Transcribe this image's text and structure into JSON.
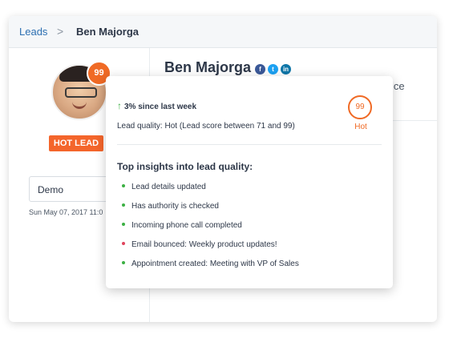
{
  "breadcrumb": {
    "parent": "Leads",
    "separator": ">",
    "current": "Ben Majorga"
  },
  "lead": {
    "name": "Ben Majorga",
    "score": "99",
    "badge": "HOT LEAD",
    "social": [
      {
        "icon": "facebook-icon",
        "glyph": "f"
      },
      {
        "icon": "twitter-icon",
        "glyph": "t"
      },
      {
        "icon": "linkedin-icon",
        "glyph": "in"
      }
    ],
    "background_fragment": "ice"
  },
  "activity": {
    "select_value": "Demo",
    "timestamp": "Sun May 07, 2017 11:0"
  },
  "popover": {
    "trend": "3% since last week",
    "trend_icon": "arrow-up-icon",
    "quality_text": "Lead quality: Hot (Lead score between 71 and 99)",
    "score": "99",
    "score_label": "Hot",
    "insights_title": "Top insights into lead quality:",
    "insights": [
      {
        "text": "Lead details updated",
        "sentiment": "positive"
      },
      {
        "text": "Has authority is checked",
        "sentiment": "positive"
      },
      {
        "text": "Incoming phone call completed",
        "sentiment": "positive"
      },
      {
        "text": "Email bounced: Weekly product updates!",
        "sentiment": "negative"
      },
      {
        "text": "Appointment created: Meeting with VP of Sales",
        "sentiment": "positive"
      }
    ]
  },
  "colors": {
    "accent": "#f06a25",
    "positive": "#3cb043",
    "negative": "#e0455d",
    "link": "#2c6fb1"
  }
}
